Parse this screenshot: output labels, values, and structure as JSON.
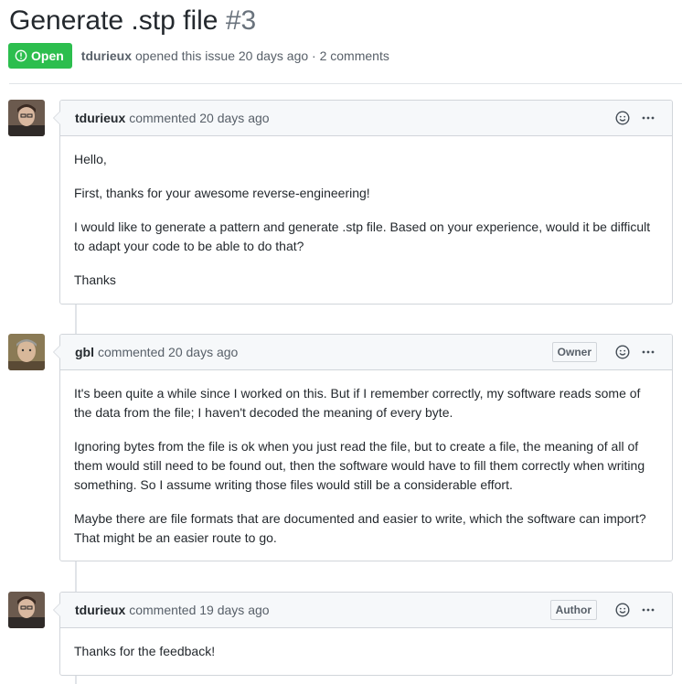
{
  "issue": {
    "title": "Generate .stp file",
    "number": "#3",
    "state": "Open",
    "author": "tdurieux",
    "meta_text": "opened this issue 20 days ago · 2 comments"
  },
  "comments": [
    {
      "author": "tdurieux",
      "action": "commented 20 days ago",
      "role": "",
      "paragraphs": [
        "Hello,",
        "First, thanks for your awesome reverse-engineering!",
        "I would like to generate a pattern and generate .stp file. Based on your experience, would it be difficult to adapt your code to be able to do that?",
        "Thanks"
      ]
    },
    {
      "author": "gbl",
      "action": "commented 20 days ago",
      "role": "Owner",
      "paragraphs": [
        "It's been quite a while since I worked on this. But if I remember correctly, my software reads some of the data from the file; I haven't decoded the meaning of every byte.",
        "Ignoring bytes from the file is ok when you just read the file, but to create a file, the meaning of all of them would still need to be found out, then the software would have to fill them correctly when writing something. So I assume writing those files would still be a considerable effort.",
        "Maybe there are file formats that are documented and easier to write, which the software can import? That might be an easier route to go."
      ]
    },
    {
      "author": "tdurieux",
      "action": "commented 19 days ago",
      "role": "Author",
      "paragraphs": [
        "Thanks for the feedback!"
      ]
    }
  ],
  "icons": {
    "state": "issue-opened-icon",
    "reaction": "smiley-icon",
    "menu": "kebab-horizontal-icon"
  },
  "colors": {
    "open_green": "#2cbe4e",
    "border": "#d1d5da",
    "header_bg": "#f6f8fa",
    "muted_text": "#586069"
  }
}
